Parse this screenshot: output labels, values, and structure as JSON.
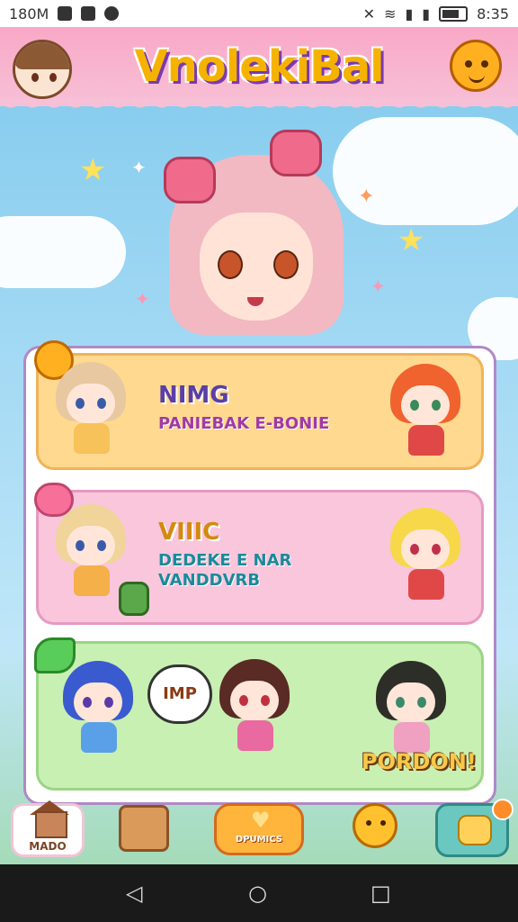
{
  "status_bar": {
    "left_text": "180M",
    "time": "8:35",
    "icons": [
      "notification-box-icon",
      "tools-icon",
      "chat-icon",
      "mute-icon",
      "wifi-icon",
      "signal-icon",
      "signal-icon",
      "battery-icon"
    ]
  },
  "header": {
    "title": "VnolekiBal",
    "avatar_icon": "girl-avatar-icon",
    "mascot_icon": "bear-mascot-icon"
  },
  "hero": {
    "character_icon": "pink-haired-girl-icon"
  },
  "cards": [
    {
      "title": "NIMG",
      "subtitle": "PANIEBAK E-BONIE",
      "badge_icon": "orange-smiley-icon",
      "left_character_icon": "blonde-chibi-icon",
      "right_character_icon": "red-haired-chibi-icon",
      "background": "#ffd98f",
      "accent": "#f0b35a"
    },
    {
      "title": "VIIIC",
      "subtitle_lines": [
        "DEDEKE E NAR",
        "VANDDVRB"
      ],
      "badge_icon": "pink-heart-icon",
      "left_character_icon": "blonde-chibi-icon",
      "right_character_icon": "yellow-haired-chibi-icon",
      "background": "#f9c6dc",
      "accent": "#e69ac0"
    },
    {
      "bubble_text": "IMP",
      "overlay_text": "PORDON!",
      "badge_icon": "green-leaf-icon",
      "character_icons": [
        "blue-haired-chibi-icon",
        "dark-haired-chibi-icon",
        "black-haired-chibi-icon"
      ],
      "background": "#c8f0b2",
      "accent": "#9bd486"
    }
  ],
  "bottom_nav": {
    "items": [
      {
        "label": "MADO",
        "icon": "house-icon"
      },
      {
        "label": "",
        "icon": "wooden-box-icon"
      },
      {
        "label": "DPUMICS",
        "icon": "heart-icon"
      },
      {
        "label": "",
        "icon": "bear-face-icon"
      },
      {
        "label": "",
        "icon": "shopping-bag-icon"
      }
    ]
  },
  "system_nav": {
    "icons": [
      "back-icon",
      "home-icon",
      "recents-icon"
    ]
  }
}
